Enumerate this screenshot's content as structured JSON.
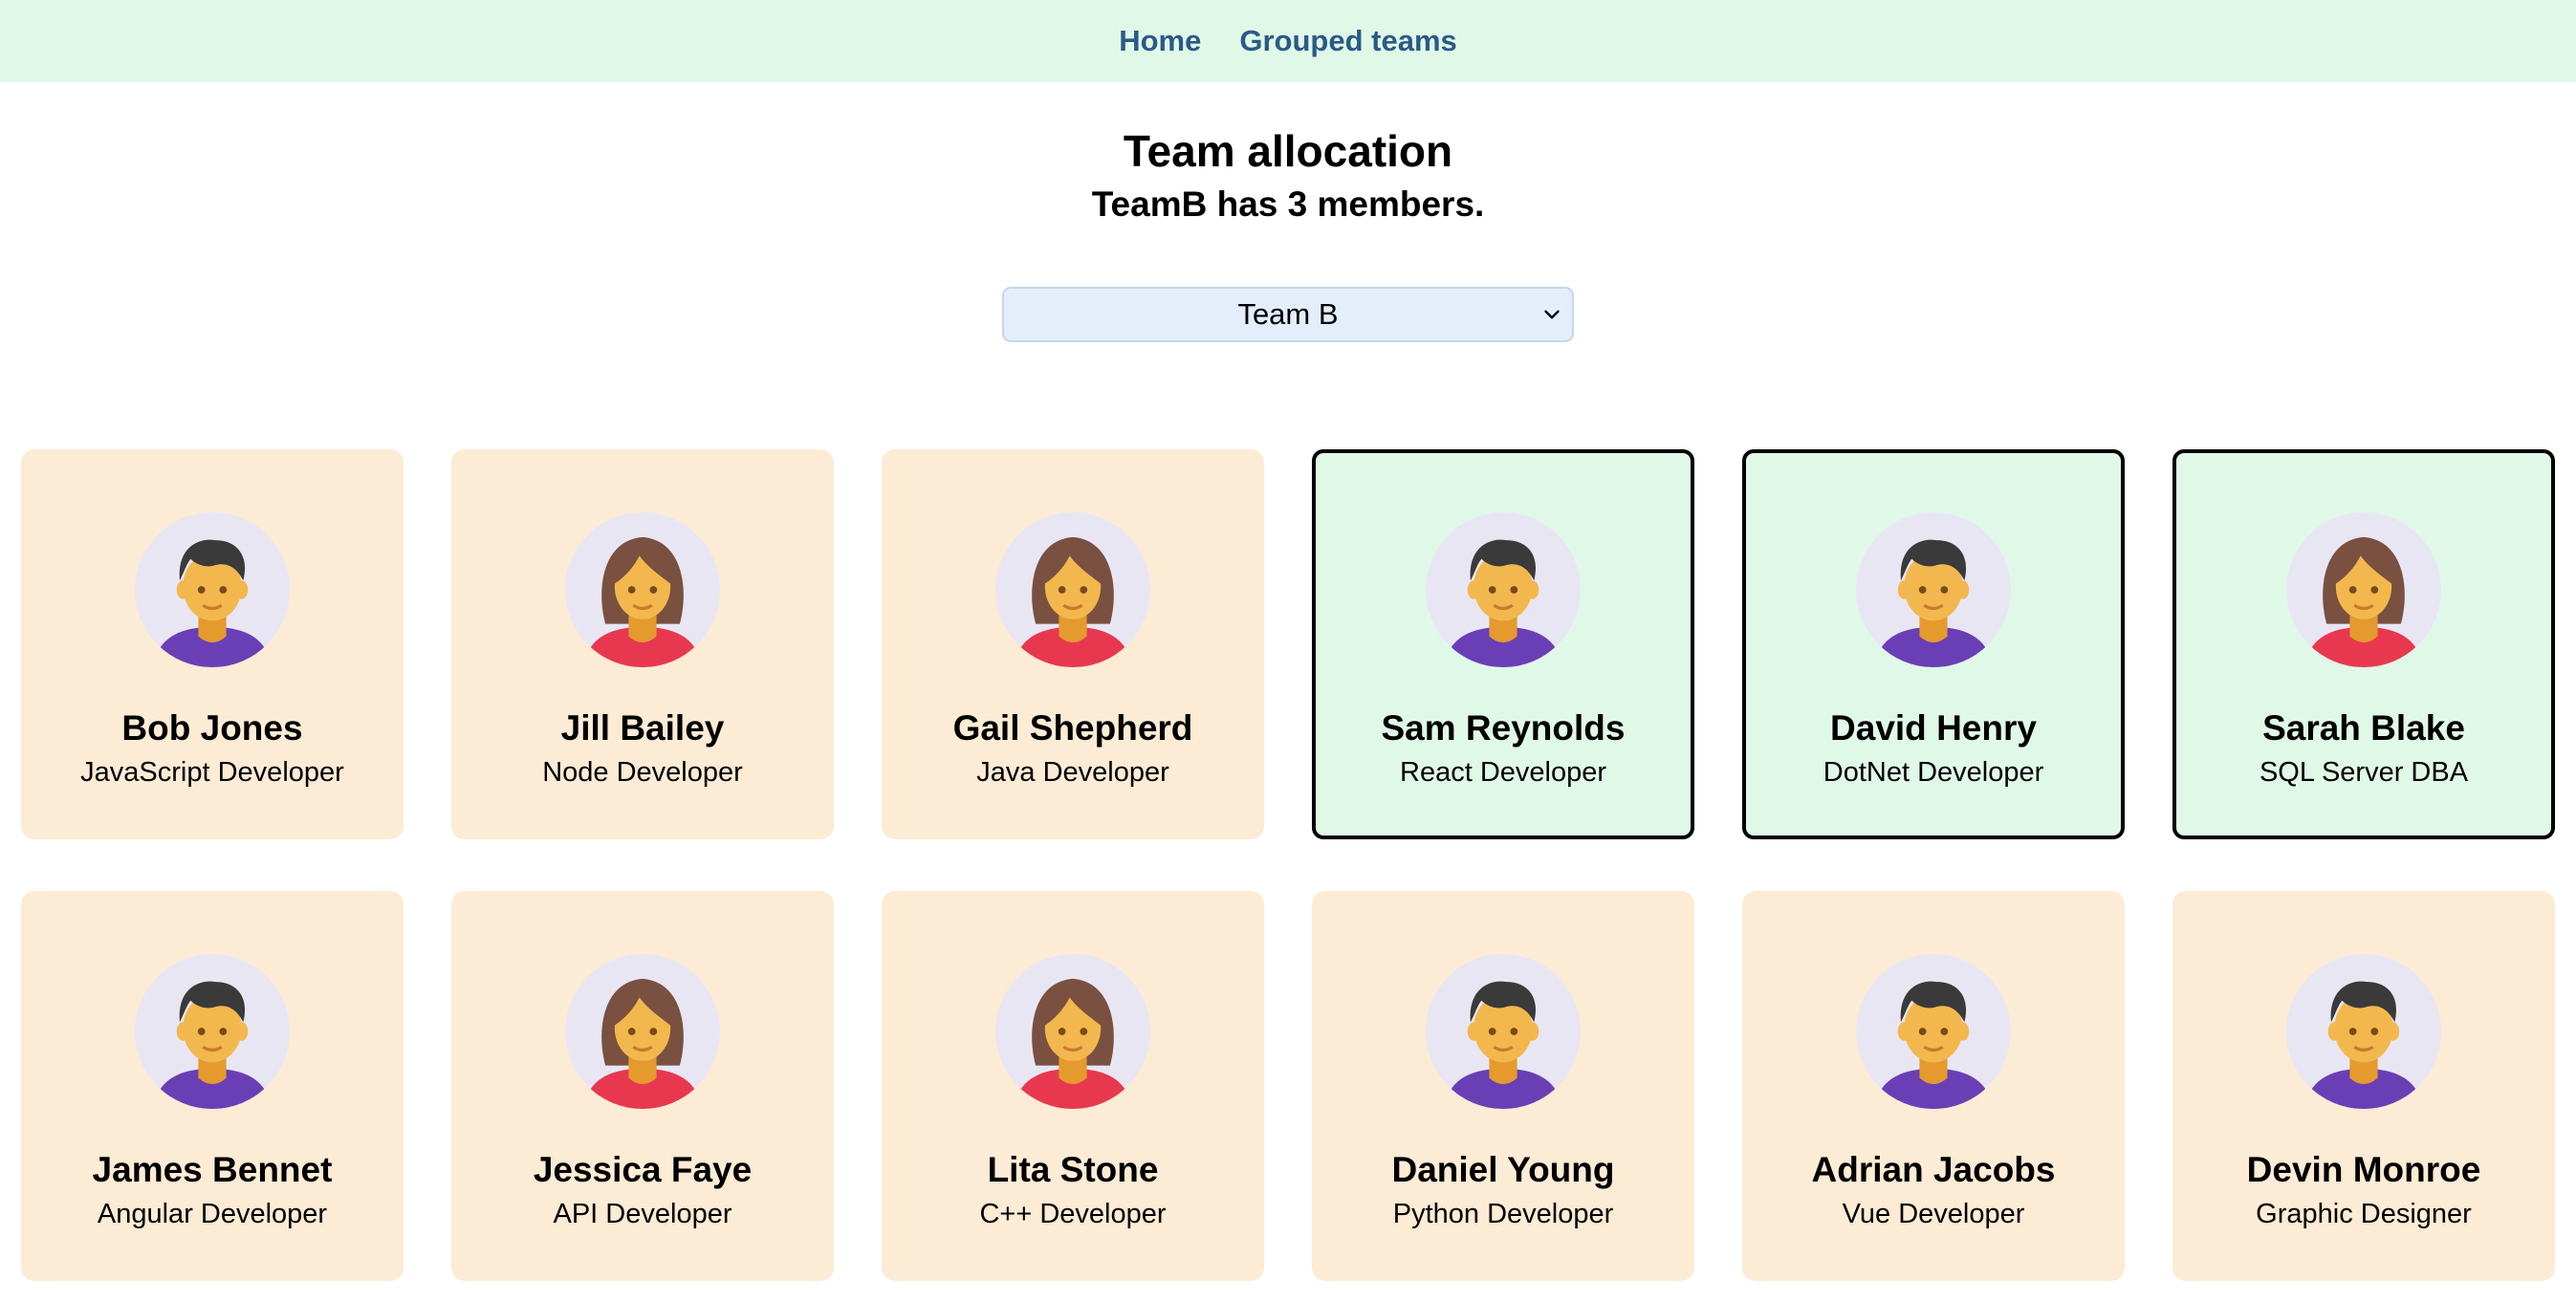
{
  "nav": {
    "home": "Home",
    "grouped": "Grouped teams"
  },
  "header": {
    "title": "Team allocation",
    "subtitle": "TeamB has 3 members."
  },
  "team_select": {
    "value": "Team B"
  },
  "colors": {
    "nav_bg": "#e0f8e8",
    "card_bg": "#fcebd5",
    "selected_card_bg": "#e0f8e8",
    "link": "#2a5a86"
  },
  "employees": [
    {
      "name": "Bob Jones",
      "role": "JavaScript Developer",
      "avatar": "male-avatar-icon",
      "selected": false
    },
    {
      "name": "Jill Bailey",
      "role": "Node Developer",
      "avatar": "female-avatar-icon",
      "selected": false
    },
    {
      "name": "Gail Shepherd",
      "role": "Java Developer",
      "avatar": "female-avatar-icon",
      "selected": false
    },
    {
      "name": "Sam Reynolds",
      "role": "React Developer",
      "avatar": "male-avatar-icon",
      "selected": true
    },
    {
      "name": "David Henry",
      "role": "DotNet Developer",
      "avatar": "male-avatar-icon",
      "selected": true
    },
    {
      "name": "Sarah Blake",
      "role": "SQL Server DBA",
      "avatar": "female-avatar-icon",
      "selected": true
    },
    {
      "name": "James Bennet",
      "role": "Angular Developer",
      "avatar": "male-avatar-icon",
      "selected": false
    },
    {
      "name": "Jessica Faye",
      "role": "API Developer",
      "avatar": "female-avatar-icon",
      "selected": false
    },
    {
      "name": "Lita Stone",
      "role": "C++ Developer",
      "avatar": "female-avatar-icon",
      "selected": false
    },
    {
      "name": "Daniel Young",
      "role": "Python Developer",
      "avatar": "male-avatar-icon",
      "selected": false
    },
    {
      "name": "Adrian Jacobs",
      "role": "Vue Developer",
      "avatar": "male-avatar-icon",
      "selected": false
    },
    {
      "name": "Devin Monroe",
      "role": "Graphic Designer",
      "avatar": "male-avatar-icon",
      "selected": false
    }
  ]
}
